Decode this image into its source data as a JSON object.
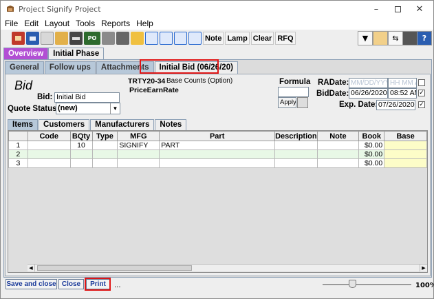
{
  "window": {
    "title": "Project Signify Project"
  },
  "menu": [
    "File",
    "Edit",
    "Layout",
    "Tools",
    "Reports",
    "Help"
  ],
  "toolbar": {
    "icons": [
      "home-icon",
      "save-icon",
      "copy-icon",
      "paste-icon",
      "print-icon",
      "po-icon",
      "trash-icon",
      "calculator-icon",
      "search-icon",
      "group-a-icon",
      "group-b-icon",
      "group-c-icon",
      "group-d-icon"
    ],
    "po_label": "PO",
    "text_buttons": [
      "Note",
      "Lamp",
      "Clear",
      "RFQ"
    ]
  },
  "main_tabs": [
    "Overview",
    "Initial Phase"
  ],
  "phase_tabs": [
    "General",
    "Follow ups",
    "Attachments",
    "Initial Bid (06/26/20)"
  ],
  "bid": {
    "heading": "Bid",
    "bid_label": "Bid:",
    "bid_value": "Initial Bid",
    "quote_status_label": "Quote Status:",
    "quote_status_value": "(new)",
    "project_code": "TRTY20-34",
    "base_counts": "Base Counts (Option)",
    "price_earn_rate": "PriceEarnRate",
    "formula_label": "Formula",
    "apply_label": "Apply",
    "ra_date_label": "RADate:",
    "ra_date_placeholder": "MM/DD/YYYY",
    "ra_time_placeholder": "HH MM A",
    "bid_date_label": "BidDate:",
    "bid_date_value": "06/26/2020",
    "bid_time_value": "08:52 AM",
    "exp_date_label": "Exp. Date:",
    "exp_date_value": "07/26/2020"
  },
  "sub_tabs": [
    "Items",
    "Customers",
    "Manufacturers",
    "Notes"
  ],
  "grid": {
    "columns": [
      "Code",
      "BQty",
      "Type",
      "MFG",
      "Part",
      "Description",
      "Note",
      "Book",
      "Base"
    ],
    "rows": [
      {
        "n": "1",
        "code": "",
        "bqty": "10",
        "type": "",
        "mfg": "SIGNIFY",
        "part": "PART",
        "description": "",
        "note": "",
        "book": "$0.00",
        "base": ""
      },
      {
        "n": "2",
        "code": "",
        "bqty": "",
        "type": "",
        "mfg": "",
        "part": "",
        "description": "",
        "note": "",
        "book": "$0.00",
        "base": ""
      },
      {
        "n": "3",
        "code": "",
        "bqty": "",
        "type": "",
        "mfg": "",
        "part": "",
        "description": "",
        "note": "",
        "book": "$0.00",
        "base": ""
      }
    ]
  },
  "footer": {
    "save_close": "Save and close",
    "close": "Close",
    "print": "Print",
    "ellipsis": "...",
    "zoom": "100%",
    "zoom_level": 1.0
  },
  "colors": {
    "highlight": "#e01515",
    "active_tab": "#6a9fd4",
    "overview_tab": "#b24fd4"
  }
}
